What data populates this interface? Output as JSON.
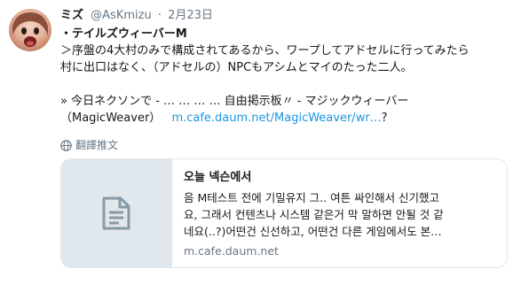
{
  "user": {
    "display_name": "ミズ",
    "handle": "@AsKmizu",
    "separator": "·",
    "date": "2月23日"
  },
  "tweet": {
    "lines": [
      "・テイルズウィーバーM",
      "＞序盤の4大村のみで構成されてあるから、ワープしてアドセルに行ってみたら",
      "村に出口はなく、（アドセルの）NPCもアシムとマイのたった二人。",
      "» 今日ネクソンで - … … … … 自由掲示板〃 - マジックウィーバー",
      "（MagicWeaver）"
    ],
    "link_text": "m.cafe.daum.net/MagicWeaver/wr…",
    "trailing": "?"
  },
  "translate_label": "翻譯推文",
  "card": {
    "title": "오늘 넥슨에서",
    "description_lines": [
      "음 M테스트 전에 기밀유지 그.. 여튼 싸인해서 신기했고",
      "요, 그래서 컨텐츠나 시스템 같은거 막 말하면 안될 것 같",
      "네요(..?)어떤건 신선하고, 어떤건 다른 게임에서도 본…"
    ],
    "domain": "m.cafe.daum.net"
  },
  "colors": {
    "link": "#1b95e0",
    "muted": "#657786",
    "border": "#e1e8ed"
  },
  "icons": {
    "translate": "globe-icon",
    "card_thumb": "document-icon",
    "avatar": "avatar"
  }
}
